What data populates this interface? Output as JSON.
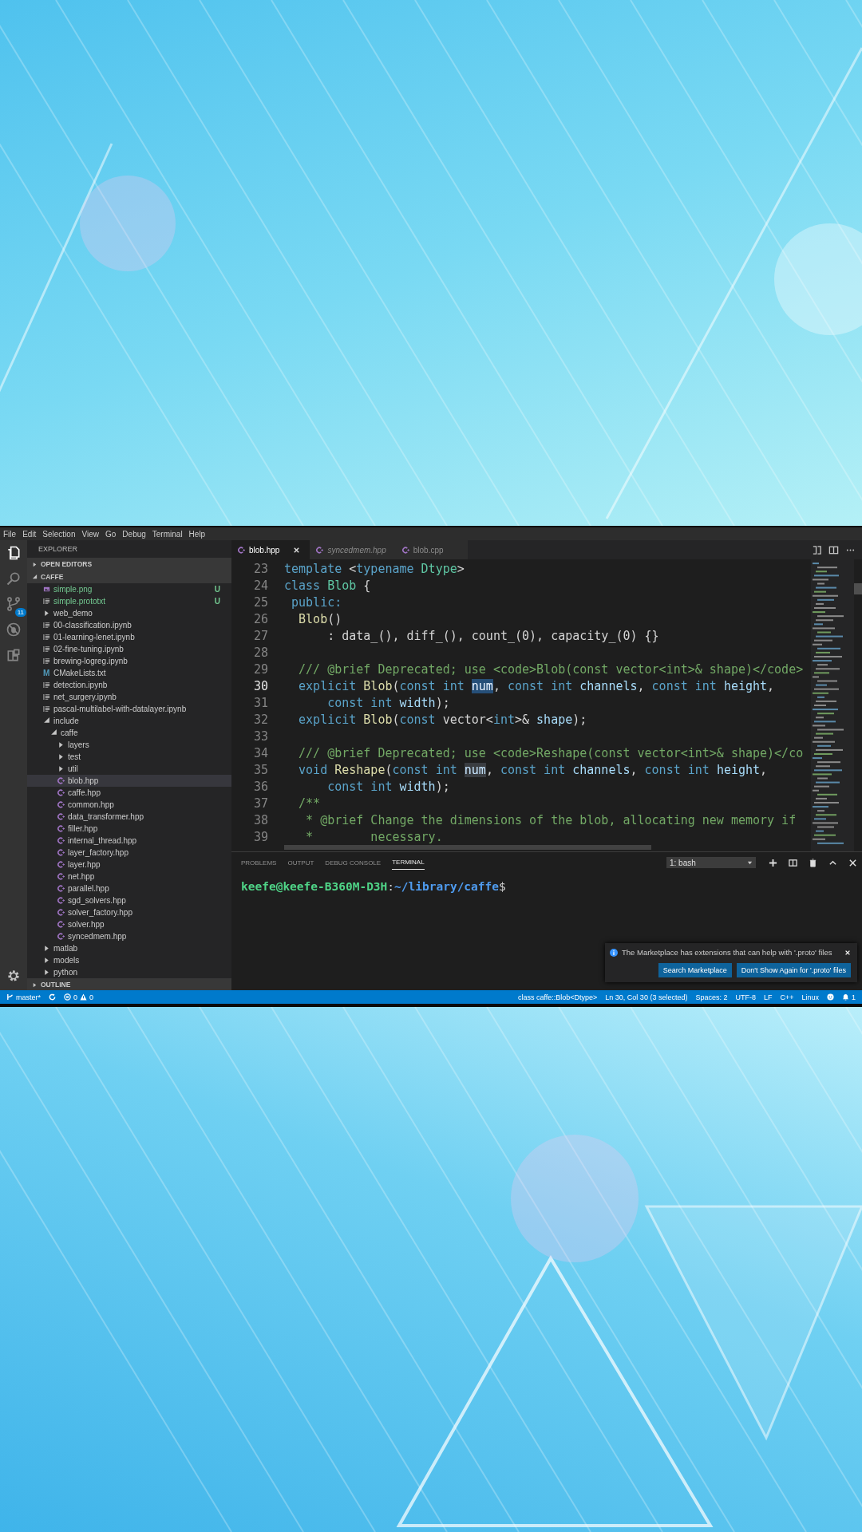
{
  "menu": [
    "File",
    "Edit",
    "Selection",
    "View",
    "Go",
    "Debug",
    "Terminal",
    "Help"
  ],
  "activity_bar": [
    {
      "kind": "explorer",
      "selected": true
    },
    {
      "kind": "search",
      "selected": false
    },
    {
      "kind": "source-control",
      "selected": false,
      "badge": "11"
    },
    {
      "kind": "debug",
      "selected": false
    },
    {
      "kind": "extensions",
      "selected": false
    }
  ],
  "sidebar": {
    "title": "EXPLORER",
    "sections": [
      {
        "label": "OPEN EDITORS",
        "expanded": false
      },
      {
        "label": "CAFFE",
        "expanded": true,
        "tree": [
          {
            "name": "simple.png",
            "kind": "image",
            "selected": false,
            "git_status": "U"
          },
          {
            "name": "simple.prototxt",
            "kind": "text",
            "selected": false,
            "git_status": "U"
          },
          {
            "name": "web_demo",
            "kind": "folder",
            "expanded": false,
            "selected": false
          },
          {
            "name": "00-classification.ipynb",
            "kind": "text",
            "selected": false
          },
          {
            "name": "01-learning-lenet.ipynb",
            "kind": "text",
            "selected": false
          },
          {
            "name": "02-fine-tuning.ipynb",
            "kind": "text",
            "selected": false
          },
          {
            "name": "brewing-logreg.ipynb",
            "kind": "text",
            "selected": false
          },
          {
            "name": "CMakeLists.txt",
            "kind": "glyph",
            "glyph": "M",
            "selected": false
          },
          {
            "name": "detection.ipynb",
            "kind": "text",
            "selected": false
          },
          {
            "name": "net_surgery.ipynb",
            "kind": "text",
            "selected": false
          },
          {
            "name": "pascal-multilabel-with-datalayer.ipynb",
            "kind": "text",
            "selected": false
          },
          {
            "name": "include",
            "kind": "folder",
            "expanded": true,
            "selected": false,
            "children": [
              {
                "name": "caffe",
                "kind": "folder",
                "expanded": true,
                "selected": false,
                "children": [
                  {
                    "name": "layers",
                    "kind": "folder",
                    "expanded": false,
                    "selected": false
                  },
                  {
                    "name": "test",
                    "kind": "folder",
                    "expanded": false,
                    "selected": false
                  },
                  {
                    "name": "util",
                    "kind": "folder",
                    "expanded": false,
                    "selected": false
                  },
                  {
                    "name": "blob.hpp",
                    "kind": "cpp",
                    "selected": true
                  },
                  {
                    "name": "caffe.hpp",
                    "kind": "cpp",
                    "selected": false
                  },
                  {
                    "name": "common.hpp",
                    "kind": "cpp",
                    "selected": false
                  },
                  {
                    "name": "data_transformer.hpp",
                    "kind": "cpp",
                    "selected": false
                  },
                  {
                    "name": "filler.hpp",
                    "kind": "cpp",
                    "selected": false
                  },
                  {
                    "name": "internal_thread.hpp",
                    "kind": "cpp",
                    "selected": false
                  },
                  {
                    "name": "layer_factory.hpp",
                    "kind": "cpp",
                    "selected": false
                  },
                  {
                    "name": "layer.hpp",
                    "kind": "cpp",
                    "selected": false
                  },
                  {
                    "name": "net.hpp",
                    "kind": "cpp",
                    "selected": false
                  },
                  {
                    "name": "parallel.hpp",
                    "kind": "cpp",
                    "selected": false
                  },
                  {
                    "name": "sgd_solvers.hpp",
                    "kind": "cpp",
                    "selected": false
                  },
                  {
                    "name": "solver_factory.hpp",
                    "kind": "cpp",
                    "selected": false
                  },
                  {
                    "name": "solver.hpp",
                    "kind": "cpp",
                    "selected": false
                  },
                  {
                    "name": "syncedmem.hpp",
                    "kind": "cpp",
                    "selected": false
                  }
                ]
              }
            ]
          },
          {
            "name": "matlab",
            "kind": "folder",
            "expanded": false,
            "selected": false
          },
          {
            "name": "models",
            "kind": "folder",
            "expanded": false,
            "selected": false
          },
          {
            "name": "python",
            "kind": "folder",
            "expanded": false,
            "selected": false
          }
        ]
      },
      {
        "label": "OUTLINE",
        "expanded": false
      }
    ]
  },
  "editor": {
    "tabs": [
      {
        "label": "blob.hpp",
        "selected": true,
        "preview": false
      },
      {
        "label": "syncedmem.hpp",
        "selected": false,
        "preview": true
      },
      {
        "label": "blob.cpp",
        "selected": false,
        "preview": false
      }
    ],
    "lines": [
      {
        "number": "23",
        "current": false,
        "tokens": [
          {
            "text": "template",
            "kind": "kw"
          },
          {
            "text": " <",
            "kind": "plain"
          },
          {
            "text": "typename ",
            "kind": "kw"
          },
          {
            "text": "Dtype",
            "kind": "type"
          },
          {
            "text": ">",
            "kind": "plain"
          }
        ]
      },
      {
        "number": "24",
        "current": false,
        "tokens": [
          {
            "text": "class ",
            "kind": "kw"
          },
          {
            "text": "Blob",
            "kind": "type"
          },
          {
            "text": " {",
            "kind": "plain"
          }
        ]
      },
      {
        "number": "25",
        "current": false,
        "tokens": [
          {
            "text": " public:",
            "kind": "kw"
          }
        ]
      },
      {
        "number": "26",
        "current": false,
        "tokens": [
          {
            "text": "  Blob",
            "kind": "func"
          },
          {
            "text": "()",
            "kind": "plain"
          }
        ]
      },
      {
        "number": "27",
        "current": false,
        "tokens": [
          {
            "text": "      : data_(), diff_(), count_(0), capacity_(0) {}",
            "kind": "plain"
          }
        ]
      },
      {
        "number": "28",
        "current": false
      },
      {
        "number": "29",
        "current": false,
        "tokens": [
          {
            "text": "  /// @brief Deprecated; use <code>Blob(const vector<int>& shape)</code>",
            "kind": "comment"
          }
        ]
      },
      {
        "number": "30",
        "current": true,
        "tokens": [
          {
            "text": "  explicit ",
            "kind": "kw"
          },
          {
            "text": "Blob",
            "kind": "func"
          },
          {
            "text": "(",
            "kind": "plain"
          },
          {
            "text": "const int ",
            "kind": "kw"
          },
          {
            "text": "num",
            "kind": "selection"
          },
          {
            "text": ", ",
            "kind": "plain"
          },
          {
            "text": "const int ",
            "kind": "kw"
          },
          {
            "text": "channels",
            "kind": "var"
          },
          {
            "text": ", ",
            "kind": "plain"
          },
          {
            "text": "const int ",
            "kind": "kw"
          },
          {
            "text": "height",
            "kind": "var"
          },
          {
            "text": ",",
            "kind": "plain"
          }
        ]
      },
      {
        "number": "31",
        "current": false,
        "tokens": [
          {
            "text": "      const int ",
            "kind": "kw"
          },
          {
            "text": "width",
            "kind": "var"
          },
          {
            "text": ");",
            "kind": "plain"
          }
        ]
      },
      {
        "number": "32",
        "current": false,
        "tokens": [
          {
            "text": "  explicit ",
            "kind": "kw"
          },
          {
            "text": "Blob",
            "kind": "func"
          },
          {
            "text": "(",
            "kind": "plain"
          },
          {
            "text": "const",
            "kind": "kw"
          },
          {
            "text": " vector<",
            "kind": "plain"
          },
          {
            "text": "int",
            "kind": "kw"
          },
          {
            "text": ">& ",
            "kind": "plain"
          },
          {
            "text": "shape",
            "kind": "var"
          },
          {
            "text": ");",
            "kind": "plain"
          }
        ]
      },
      {
        "number": "33",
        "current": false
      },
      {
        "number": "34",
        "current": false,
        "tokens": [
          {
            "text": "  /// @brief Deprecated; use <code>Reshape(const vector<int>& shape)</co",
            "kind": "comment"
          }
        ]
      },
      {
        "number": "35",
        "current": false,
        "tokens": [
          {
            "text": "  void ",
            "kind": "kw"
          },
          {
            "text": "Reshape",
            "kind": "func"
          },
          {
            "text": "(",
            "kind": "plain"
          },
          {
            "text": "const int ",
            "kind": "kw"
          },
          {
            "text": "num",
            "kind": "match"
          },
          {
            "text": ", ",
            "kind": "plain"
          },
          {
            "text": "const int ",
            "kind": "kw"
          },
          {
            "text": "channels",
            "kind": "var"
          },
          {
            "text": ", ",
            "kind": "plain"
          },
          {
            "text": "const int ",
            "kind": "kw"
          },
          {
            "text": "height",
            "kind": "var"
          },
          {
            "text": ",",
            "kind": "plain"
          }
        ]
      },
      {
        "number": "36",
        "current": false,
        "tokens": [
          {
            "text": "      const int ",
            "kind": "kw"
          },
          {
            "text": "width",
            "kind": "var"
          },
          {
            "text": ");",
            "kind": "plain"
          }
        ]
      },
      {
        "number": "37",
        "current": false,
        "tokens": [
          {
            "text": "  /**",
            "kind": "comment"
          }
        ]
      },
      {
        "number": "38",
        "current": false,
        "tokens": [
          {
            "text": "   * @brief Change the dimensions of the blob, allocating new memory if",
            "kind": "comment"
          }
        ]
      },
      {
        "number": "39",
        "current": false,
        "tokens": [
          {
            "text": "   *        necessary.",
            "kind": "comment"
          }
        ]
      }
    ]
  },
  "panel": {
    "tabs": [
      {
        "label": "PROBLEMS",
        "selected": false
      },
      {
        "label": "OUTPUT",
        "selected": false
      },
      {
        "label": "DEBUG CONSOLE",
        "selected": false
      },
      {
        "label": "TERMINAL",
        "selected": true
      }
    ],
    "terminal_selector": "1: bash",
    "terminal_prompt": [
      {
        "text": "keefe@keefe-B360M-D3H",
        "kind": "user"
      },
      {
        "text": ":",
        "kind": "plain"
      },
      {
        "text": "~/library/caffe",
        "kind": "path"
      },
      {
        "text": "$",
        "kind": "plain"
      }
    ]
  },
  "notification": {
    "message": "The Marketplace has extensions that can help with '.proto' files",
    "buttons": [
      "Search Marketplace",
      "Don't Show Again for '.proto' files"
    ]
  },
  "status_bar": {
    "branch": "master*",
    "errors": "0",
    "warnings": "0",
    "items": [
      "class caffe::Blob<Dtype>",
      "Ln 30, Col 30 (3 selected)",
      "Spaces: 2",
      "UTF-8",
      "LF",
      "C++",
      "Linux"
    ],
    "notifications": "1"
  }
}
